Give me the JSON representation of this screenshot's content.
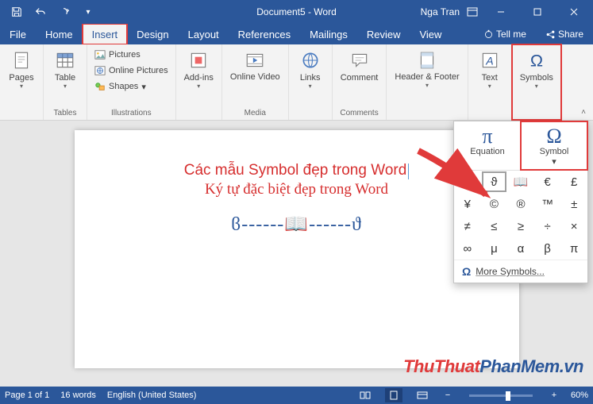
{
  "titlebar": {
    "doc_title": "Document5 - Word",
    "user_name": "Nga Tran"
  },
  "tabs": {
    "file": "File",
    "home": "Home",
    "insert": "Insert",
    "design": "Design",
    "layout": "Layout",
    "references": "References",
    "mailings": "Mailings",
    "review": "Review",
    "view": "View",
    "tellme": "Tell me",
    "share": "Share"
  },
  "ribbon": {
    "pages": {
      "label": "Pages",
      "group": ""
    },
    "table": {
      "label": "Table",
      "group": "Tables"
    },
    "illustrations": {
      "pictures": "Pictures",
      "online_pictures": "Online Pictures",
      "shapes": "Shapes",
      "group": "Illustrations"
    },
    "addins": {
      "label": "Add-ins",
      "group": ""
    },
    "media": {
      "label": "Online Video",
      "group": "Media"
    },
    "links": {
      "label": "Links",
      "group": ""
    },
    "comment": {
      "label": "Comment",
      "group": "Comments"
    },
    "header_footer": {
      "label": "Header & Footer",
      "group": ""
    },
    "text": {
      "label": "Text",
      "group": ""
    },
    "symbols": {
      "label": "Symbols",
      "group": ""
    }
  },
  "symbol_dropdown": {
    "equation": "Equation",
    "symbol": "Symbol",
    "grid": [
      "ϐ",
      "ϑ",
      "📖",
      "€",
      "£",
      "¥",
      "©",
      "®",
      "™",
      "±",
      "≠",
      "≤",
      "≥",
      "÷",
      "×",
      "∞",
      "μ",
      "α",
      "β",
      "π"
    ],
    "more": "More Symbols..."
  },
  "document": {
    "line1": "Các mẫu Symbol đẹp trong Word",
    "line2": "Ký tự đặc biệt đẹp trong Word",
    "deco": "ϐ------📖------ϑ"
  },
  "watermark": {
    "a": "ThuThuat",
    "b": "PhanMem",
    "c": ".vn"
  },
  "statusbar": {
    "page": "Page 1 of 1",
    "words": "16 words",
    "lang": "English (United States)",
    "zoom": "60%"
  }
}
